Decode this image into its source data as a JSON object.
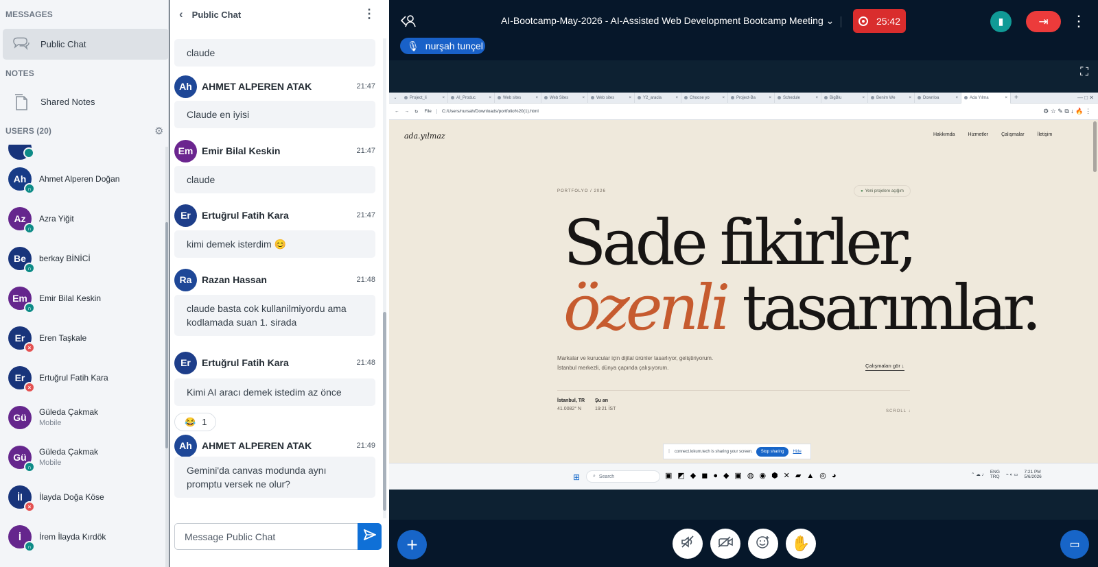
{
  "sidebar": {
    "messages_title": "MESSAGES",
    "public_chat": "Public Chat",
    "notes_title": "NOTES",
    "shared_notes": "Shared Notes",
    "users_title": "USERS (20)",
    "users": [
      {
        "initials": "Ah",
        "name": "Ahmet Alperen Doğan",
        "sub": "",
        "color": "#173b86",
        "status": "headset",
        "status_color": "#0d8b87"
      },
      {
        "initials": "Az",
        "name": "Azra Yiğit",
        "sub": "",
        "color": "#65268d",
        "status": "headset",
        "status_color": "#0d8b87"
      },
      {
        "initials": "Be",
        "name": "berkay BİNİCİ",
        "sub": "",
        "color": "#18347b",
        "status": "headset",
        "status_color": "#0d8b87"
      },
      {
        "initials": "Em",
        "name": "Emir Bilal Keskin",
        "sub": "",
        "color": "#65268d",
        "status": "headset",
        "status_color": "#0d8b87"
      },
      {
        "initials": "Er",
        "name": "Eren Taşkale",
        "sub": "",
        "color": "#18347b",
        "status": "muted",
        "status_color": "#e45151"
      },
      {
        "initials": "Er",
        "name": "Ertuğrul Fatih Kara",
        "sub": "",
        "color": "#18347b",
        "status": "muted",
        "status_color": "#e45151"
      },
      {
        "initials": "Gü",
        "name": "Güleda Çakmak",
        "sub": "Mobile",
        "color": "#65268d",
        "status": "",
        "status_color": ""
      },
      {
        "initials": "Gü",
        "name": "Güleda Çakmak",
        "sub": "Mobile",
        "color": "#65268d",
        "status": "headset",
        "status_color": "#0d8b87"
      },
      {
        "initials": "İl",
        "name": "İlayda Doğa Köse",
        "sub": "",
        "color": "#18347b",
        "status": "muted",
        "status_color": "#e45151"
      },
      {
        "initials": "İ",
        "name": "İrem İlayda Kırdök",
        "sub": "",
        "color": "#65268d",
        "status": "headset",
        "status_color": "#0d8b87"
      }
    ]
  },
  "chat": {
    "title": "Public Chat",
    "placeholder": "Message Public Chat",
    "messages": [
      {
        "kind": "text",
        "text": "claude"
      },
      {
        "kind": "head",
        "initials": "Ah",
        "name": "AHMET ALPEREN ATAK",
        "time": "21:47",
        "color": "#1e4797"
      },
      {
        "kind": "text",
        "text": "Claude en iyisi"
      },
      {
        "kind": "head",
        "initials": "Em",
        "name": "Emir Bilal Keskin",
        "time": "21:47",
        "color": "#6b258f"
      },
      {
        "kind": "text",
        "text": "claude"
      },
      {
        "kind": "head",
        "initials": "Er",
        "name": "Ertuğrul Fatih Kara",
        "time": "21:47",
        "color": "#1e3e8a"
      },
      {
        "kind": "text",
        "text": "kimi demek isterdim 😊"
      },
      {
        "kind": "head",
        "initials": "Ra",
        "name": "Razan Hassan",
        "time": "21:48",
        "color": "#1e4797"
      },
      {
        "kind": "text",
        "text": "claude basta cok kullanilmiyordu ama kodlamada suan 1. sirada"
      },
      {
        "kind": "head",
        "initials": "Er",
        "name": "Ertuğrul Fatih Kara",
        "time": "21:48",
        "color": "#1e3e8a"
      },
      {
        "kind": "text",
        "text": "Kimi AI aracı demek istedim az önce"
      },
      {
        "kind": "head",
        "initials": "Ah",
        "name": "AHMET ALPEREN ATAK",
        "time": "21:49",
        "color": "#1e4797"
      },
      {
        "kind": "text",
        "text": "Gemini'da canvas modunda aynı promptu versek ne olur?"
      }
    ],
    "reaction": {
      "emoji": "😂",
      "count": "1"
    }
  },
  "meeting": {
    "title": "AI-Bootcamp-May-2026 - AI-Assisted Web Development Bootcamp Meeting",
    "timer": "25:42",
    "presenter": "nurşah tunçel"
  },
  "shared_page": {
    "tabs": [
      "Project_li",
      "AI_Produc",
      "Web sites",
      "Web Sites",
      "Web sites",
      "Y2_aracla",
      "Choose yo",
      "Project-Ba",
      "Schedule",
      "BigBlu",
      "Benim We",
      "Downloa",
      "Ada Yılma"
    ],
    "file_label": "File",
    "url": "C:/Users/nursah/Downloads/portfolio%20(1).html",
    "logo": "ada.yılmaz",
    "nav": [
      "Hakkımda",
      "Hizmetler",
      "Çalışmalar",
      "İletişim"
    ],
    "kicker": "PORTFOLYO / 2026",
    "open_badge": "Yeni projelere açığım",
    "hero_line1": "Sade fikirler,",
    "hero_line2_a": "özenli",
    "hero_line2_b": " tasarımlar.",
    "desc1": "Markalar ve kurucular için dijital ürünler tasarlıyor, geliştiriyorum.",
    "desc2": "İstanbul merkezli, dünya çapında çalışıyorum.",
    "cta": "Çalışmaları gör ↓",
    "loc_title": "İstanbul, TR",
    "loc_value": "41.0082° N",
    "now_title": "Şu an",
    "now_value": "19:21 İST",
    "scroll": "SCROLL ↓",
    "share_notice": "connect.lokum.tech is sharing your screen.",
    "stop_sharing": "Stop sharing",
    "hide": "Hide",
    "search": "Search",
    "lang1": "ENG",
    "lang2": "TRQ",
    "clock": "7:21 PM",
    "date": "5/6/2026"
  }
}
